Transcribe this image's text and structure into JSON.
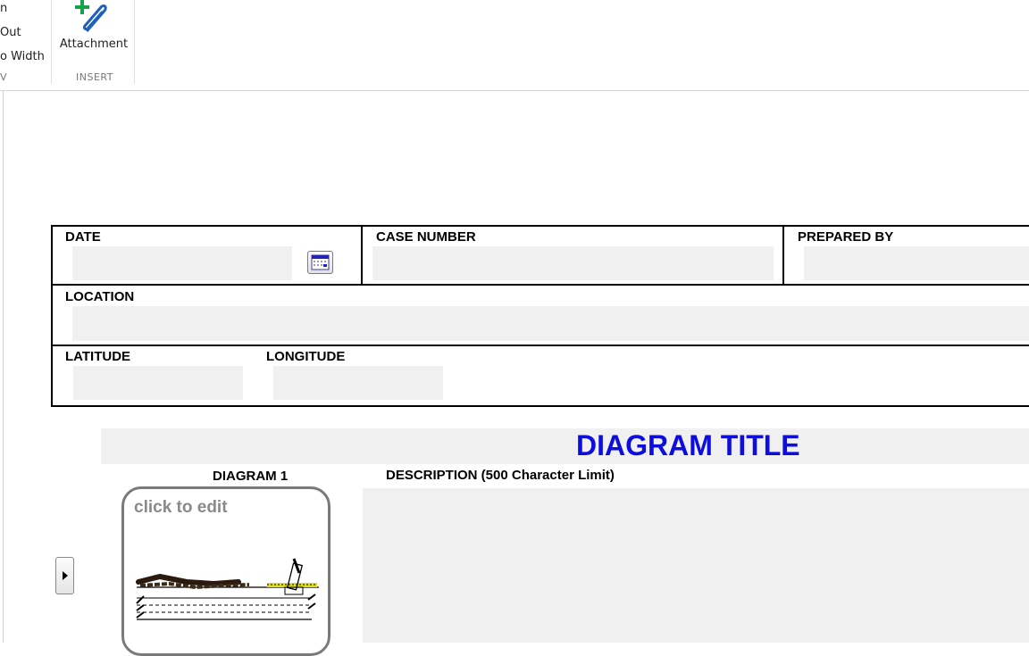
{
  "ribbon": {
    "view_group": {
      "items": [
        "n",
        "Out",
        "o Width"
      ],
      "label": "V"
    },
    "insert_group": {
      "attachment_label": "Attachment",
      "label": "INSERT"
    }
  },
  "form": {
    "date": {
      "label": "DATE",
      "value": ""
    },
    "case_number": {
      "label": "CASE NUMBER",
      "value": ""
    },
    "prepared_by": {
      "label": "PREPARED BY",
      "value": ""
    },
    "location": {
      "label": "LOCATION",
      "value": ""
    },
    "latitude": {
      "label": "LATITUDE",
      "value": ""
    },
    "longitude": {
      "label": "LONGITUDE",
      "value": ""
    }
  },
  "diagram": {
    "title": "DIAGRAM TITLE",
    "diagram1_label": "DIAGRAM 1",
    "click_to_edit": "click to edit",
    "description_label": "DESCRIPTION (500 Character Limit)",
    "description_value": ""
  },
  "colors": {
    "title_blue": "#0d0dde",
    "field_bg": "#f0f0f0",
    "clip_blue": "#1f5fbf",
    "plus_green": "#17a34a"
  },
  "icons": {
    "attachment": "paperclip-plus-icon",
    "calendar": "calendar-icon",
    "expand": "chevron-right-icon"
  }
}
